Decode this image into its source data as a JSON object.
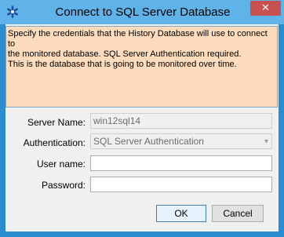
{
  "window": {
    "title": "Connect to SQL Server Database",
    "close_glyph": "✕",
    "app_icon": "snowflake-asterisk-icon",
    "accent_color": "#2b8ccf"
  },
  "message": {
    "text": "Specify the credentials that the History Database will use to connect to\nthe monitored database.  SQL Server Authentication required.\nThis is the database that is going to be monitored over time."
  },
  "form": {
    "server_name_label": "Server Name:",
    "server_name_value": "win12sql14",
    "authentication_label": "Authentication:",
    "authentication_value": "SQL Server Authentication",
    "username_label": "User name:",
    "username_value": "",
    "password_label": "Password:",
    "password_value": ""
  },
  "buttons": {
    "ok_label": "OK",
    "cancel_label": "Cancel"
  }
}
